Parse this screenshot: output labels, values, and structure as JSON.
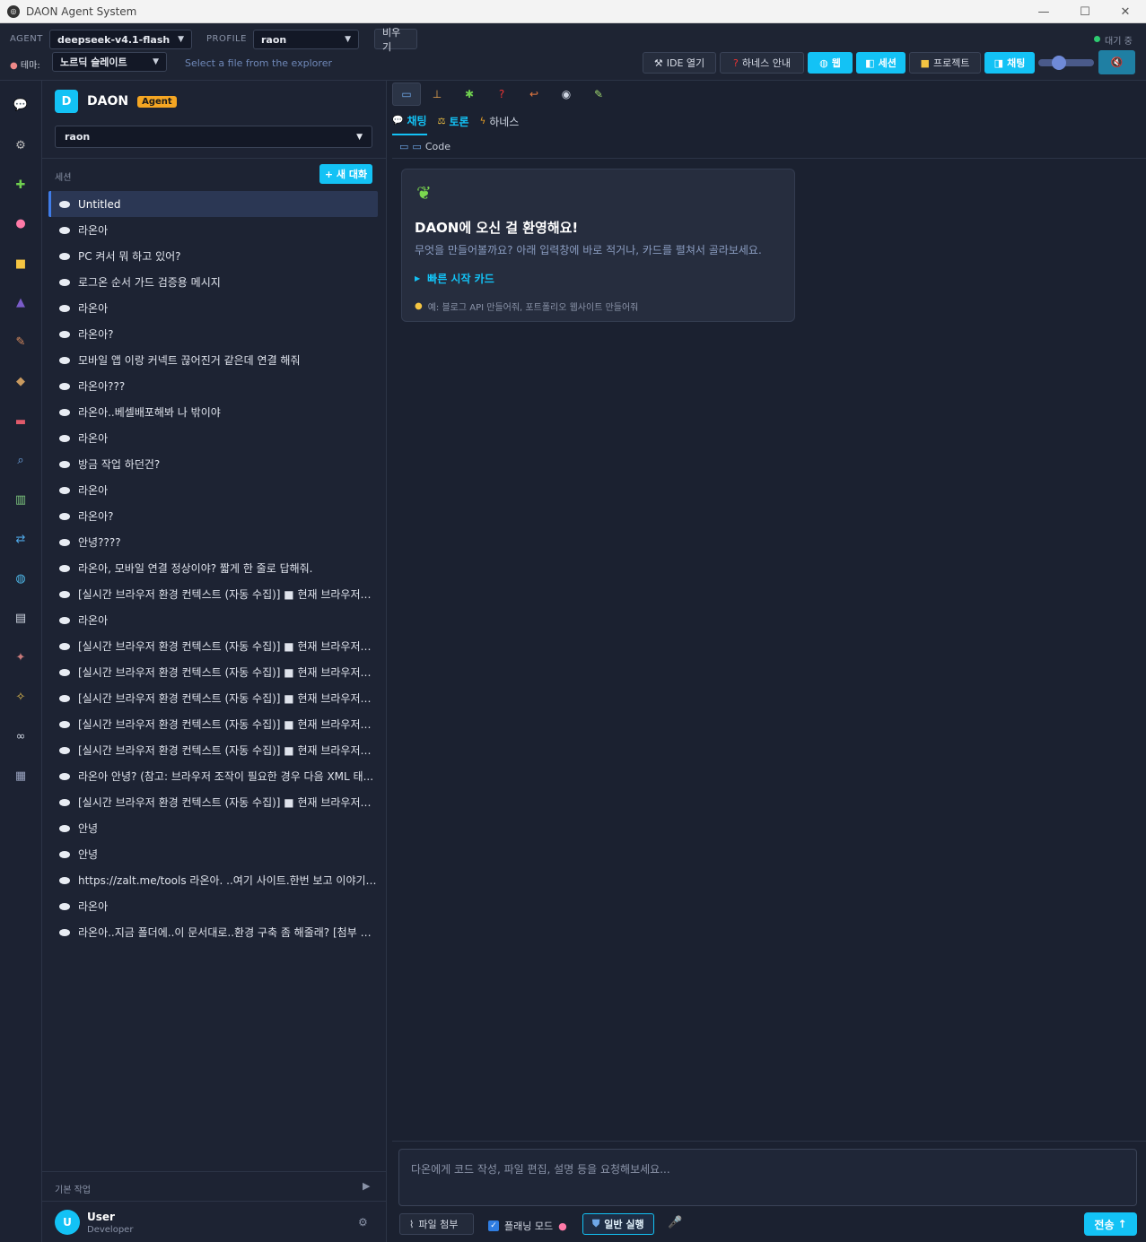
{
  "window": {
    "title": "DAON Agent System",
    "minimize": "—",
    "maximize": "☐",
    "close": "✕"
  },
  "header": {
    "agent_label": "AGENT",
    "agent_value": "deepseek-v4.1-flash",
    "profile_label": "PROFILE",
    "profile_value": "raon",
    "clear_button": "비우기",
    "status": "대기 중",
    "theme_label": "테마:",
    "theme_value": "노르딕 슬레이트",
    "file_hint": "Select a file from the explorer",
    "buttons": {
      "ide": "IDE 열기",
      "harness_guide": "하네스 안내",
      "web": "웹",
      "session": "세션",
      "project": "프로젝트",
      "chat": "채팅"
    }
  },
  "sidebar": {
    "brand_letter": "D",
    "brand_name": "DAON",
    "brand_tag": "Agent",
    "profile_value": "raon",
    "sessions_label": "세션",
    "new_chat": "+ 새 대화",
    "sessions": [
      "Untitled",
      "라온아",
      "PC 켜서 뭐 하고 있어?",
      "로그온 순서 가드 검증용 메시지",
      "라온아",
      "라온아?",
      "모바일 앱 이랑 커넥트 끊어진거 같은데 연결 해줘",
      "라온아???",
      "라온아..베셀배포해봐 나 밖이야",
      "라온아",
      "방금 작업 하던건?",
      "라온아",
      "라온아?",
      "안녕????",
      "라온아, 모바일 연결 정상이야? 짧게 한 줄로 답해줘.",
      "[실시간 브라우저 환경 컨텍스트 (자동 수집)] ■ 현재 브라우저에...",
      "라온아",
      "[실시간 브라우저 환경 컨텍스트 (자동 수집)] ■ 현재 브라우저에...",
      "[실시간 브라우저 환경 컨텍스트 (자동 수집)] ■ 현재 브라우저에...",
      "[실시간 브라우저 환경 컨텍스트 (자동 수집)] ■ 현재 브라우저에...",
      "[실시간 브라우저 환경 컨텍스트 (자동 수집)] ■ 현재 브라우저에...",
      "[실시간 브라우저 환경 컨텍스트 (자동 수집)] ■ 현재 브라우저에...",
      "라온아 안녕? (참고: 브라우저 조작이 필요한 경우 다음 XML 태...",
      "[실시간 브라우저 환경 컨텍스트 (자동 수집)] ■ 현재 브라우저에...",
      "안녕",
      "안녕",
      "https://zalt.me/tools 라온아. ..여기 사이트.한번 보고 이야기해봐",
      "라온아",
      "라온아..지금 폴더에..이 문서대로..환경 구축 좀 해줄래? [첨부 파..."
    ],
    "tasks_label": "기본 작업",
    "user_initial": "U",
    "user_name": "User",
    "user_role": "Developer"
  },
  "main": {
    "tabs": {
      "chat": "채팅",
      "debate": "토론",
      "harness": "하네스"
    },
    "code_label": "Code",
    "welcome": {
      "title": "DAON에 오신 걸 환영해요!",
      "subtitle": "무엇을 만들어볼까요? 아래 입력창에 바로 적거나, 카드를 펼쳐서 골라보세요.",
      "quick_cards": "빠른 시작 카드",
      "hint": "예: 블로그 API 만들어줘, 포트폴리오 웹사이트 만들어줘"
    },
    "input_placeholder": "다온에게 코드 작성, 파일 편집, 설명 등을 요청해보세요...",
    "attach": "파일 첨부",
    "planning_mode": "플래닝 모드",
    "run_mode": "일반 실행",
    "send": "전송"
  },
  "colors": {
    "accent": "#13c2f5",
    "background": "#1b2130",
    "sidebar": "#1d2333",
    "badge": "#f5a623",
    "status": "#2ecc71"
  }
}
